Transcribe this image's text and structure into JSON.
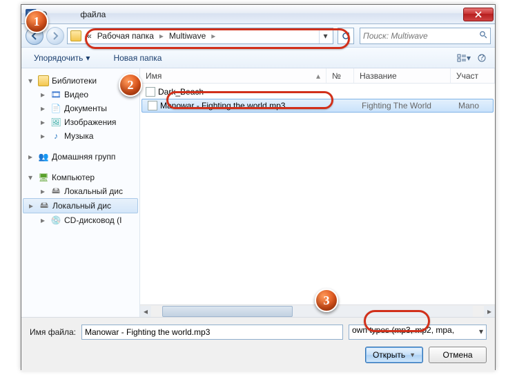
{
  "window": {
    "title": "файла"
  },
  "nav": {
    "crumb_prefix": "«",
    "crumb1": "Рабочая папка",
    "crumb2": "Multiwave",
    "search_placeholder": "Поиск: Multiwave"
  },
  "toolbar": {
    "organize": "Упорядочить",
    "newfolder": "Новая папка"
  },
  "sidebar": {
    "libraries": "Библиотеки",
    "video": "Видео",
    "documents": "Документы",
    "images": "Изображения",
    "music": "Музыка",
    "homegroup": "Домашняя групп",
    "computer": "Компьютер",
    "disk1": "Локальный дис",
    "disk2": "Локальный дис",
    "cd": "CD-дисковод (I"
  },
  "columns": {
    "name": "Имя",
    "num": "№",
    "title": "Название",
    "artist": "Участ"
  },
  "files": [
    {
      "name": "Dark_Beach",
      "num": "",
      "title": "",
      "artist": ""
    },
    {
      "name": "Manowar - Fighting the world.mp3",
      "num": "",
      "title": "Fighting The World",
      "artist": "Mano"
    }
  ],
  "bottom": {
    "label": "Имя файла:",
    "value": "Manowar - Fighting the world.mp3",
    "filter": "own types (mp3, mp2, mpa,",
    "open": "Открыть",
    "cancel": "Отмена"
  },
  "callouts": {
    "c1": "1",
    "c2": "2",
    "c3": "3"
  }
}
